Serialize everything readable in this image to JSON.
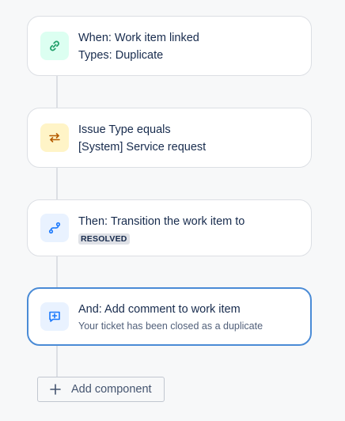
{
  "rule": {
    "steps": [
      {
        "kind": "trigger",
        "icon": "link-icon",
        "icon_color": "#22a06b",
        "icon_bg": "#dcfff1",
        "line1": "When: Work item linked",
        "line2": "Types: Duplicate"
      },
      {
        "kind": "condition",
        "icon": "swap-arrows-icon",
        "icon_color": "#b65c02",
        "icon_bg": "#fff4c7",
        "line1": "Issue Type equals",
        "line2": "[System] Service request"
      },
      {
        "kind": "action",
        "icon": "transition-icon",
        "icon_color": "#1d7afc",
        "icon_bg": "#e9f2ff",
        "line1": "Then: Transition the work item to",
        "status": "RESOLVED"
      },
      {
        "kind": "action",
        "icon": "add-comment-icon",
        "icon_color": "#1d7afc",
        "icon_bg": "#e9f2ff",
        "line1": "And: Add comment to work item",
        "line2": "Your ticket has been closed as a duplicate",
        "selected": true
      }
    ],
    "add_component_label": "Add component"
  },
  "colors": {
    "selected_border": "#4a8bd6",
    "connector": "#dcdfe4"
  }
}
